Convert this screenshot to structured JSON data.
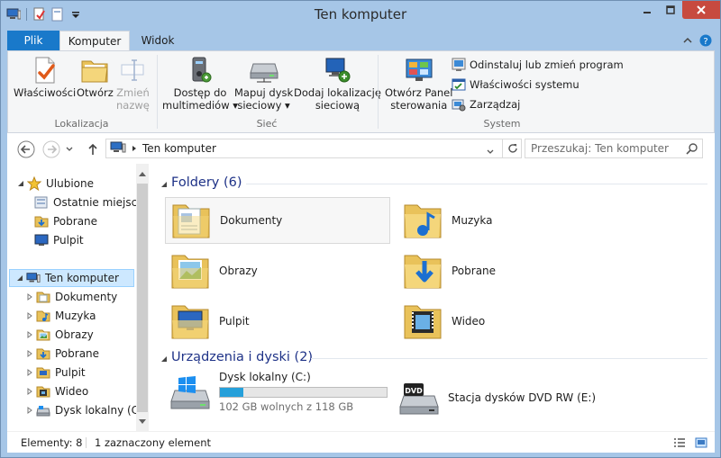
{
  "window": {
    "title": "Ten komputer"
  },
  "quick_access": {
    "icons": [
      "computer-icon",
      "properties-icon",
      "new-folder-icon",
      "customize-qat-icon"
    ]
  },
  "ribbon": {
    "tabs": [
      {
        "label": "Plik"
      },
      {
        "label": "Komputer",
        "active": true
      },
      {
        "label": "Widok"
      }
    ],
    "groups": {
      "lokalizacja": {
        "label": "Lokalizacja",
        "buttons": [
          {
            "label": "Właściwości",
            "icon": "properties-check-icon"
          },
          {
            "label": "Otwórz",
            "icon": "open-folder-icon"
          },
          {
            "label1": "Zmień",
            "label2": "nazwę",
            "icon": "rename-icon",
            "disabled": true
          }
        ]
      },
      "siec": {
        "label": "Sieć",
        "buttons": [
          {
            "label1": "Dostęp do",
            "label2": "multimediów",
            "icon": "media-access-icon"
          },
          {
            "label1": "Mapuj dysk",
            "label2": "sieciowy",
            "icon": "map-drive-icon"
          },
          {
            "label1": "Dodaj lokalizację",
            "label2": "sieciową",
            "icon": "add-network-location-icon"
          }
        ]
      },
      "system": {
        "label": "System",
        "big_button": {
          "label1": "Otwórz Panel",
          "label2": "sterowania",
          "icon": "control-panel-icon"
        },
        "small_buttons": [
          {
            "label": "Odinstaluj lub zmień program",
            "icon": "uninstall-icon"
          },
          {
            "label": "Właściwości systemu",
            "icon": "system-properties-icon"
          },
          {
            "label": "Zarządzaj",
            "icon": "manage-icon"
          }
        ]
      }
    }
  },
  "address_bar": {
    "path": "Ten komputer"
  },
  "search": {
    "placeholder": "Przeszukaj: Ten komputer"
  },
  "nav_pane": {
    "favorites": {
      "label": "Ulubione",
      "items": [
        {
          "label": "Ostatnie miejsca",
          "icon": "recent-places-icon"
        },
        {
          "label": "Pobrane",
          "icon": "downloads-folder-icon"
        },
        {
          "label": "Pulpit",
          "icon": "desktop-icon"
        }
      ]
    },
    "computer": {
      "label": "Ten komputer",
      "items": [
        {
          "label": "Dokumenty",
          "icon": "documents-folder-icon"
        },
        {
          "label": "Muzyka",
          "icon": "music-folder-icon"
        },
        {
          "label": "Obrazy",
          "icon": "pictures-folder-icon"
        },
        {
          "label": "Pobrane",
          "icon": "downloads-folder-icon"
        },
        {
          "label": "Pulpit",
          "icon": "desktop-folder-icon"
        },
        {
          "label": "Wideo",
          "icon": "videos-folder-icon"
        },
        {
          "label": "Dysk lokalny (C:)",
          "icon": "local-disk-icon"
        }
      ]
    }
  },
  "content": {
    "folders_header": "Foldery (6)",
    "folders": [
      {
        "label": "Dokumenty",
        "icon": "documents-folder-icon",
        "selected": true
      },
      {
        "label": "Muzyka",
        "icon": "music-folder-icon"
      },
      {
        "label": "Obrazy",
        "icon": "pictures-folder-icon"
      },
      {
        "label": "Pobrane",
        "icon": "downloads-folder-icon"
      },
      {
        "label": "Pulpit",
        "icon": "desktop-folder-icon"
      },
      {
        "label": "Wideo",
        "icon": "videos-folder-icon"
      }
    ],
    "devices_header": "Urządzenia i dyski (2)",
    "devices": [
      {
        "label": "Dysk lokalny (C:)",
        "free_text": "102 GB wolnych z 118 GB",
        "used_fraction": 0.14,
        "icon": "windows-drive-icon"
      },
      {
        "label": "Stacja dysków DVD RW (E:)",
        "icon": "dvd-drive-icon"
      }
    ]
  },
  "status_bar": {
    "items_count": "Elementy: 8",
    "selected_count": "1 zaznaczony element"
  },
  "colors": {
    "accent": "#1979ca",
    "frame": "#a6c6e7",
    "close": "#c74a3f",
    "progress": "#26a0da",
    "section_head": "#1e3287"
  }
}
